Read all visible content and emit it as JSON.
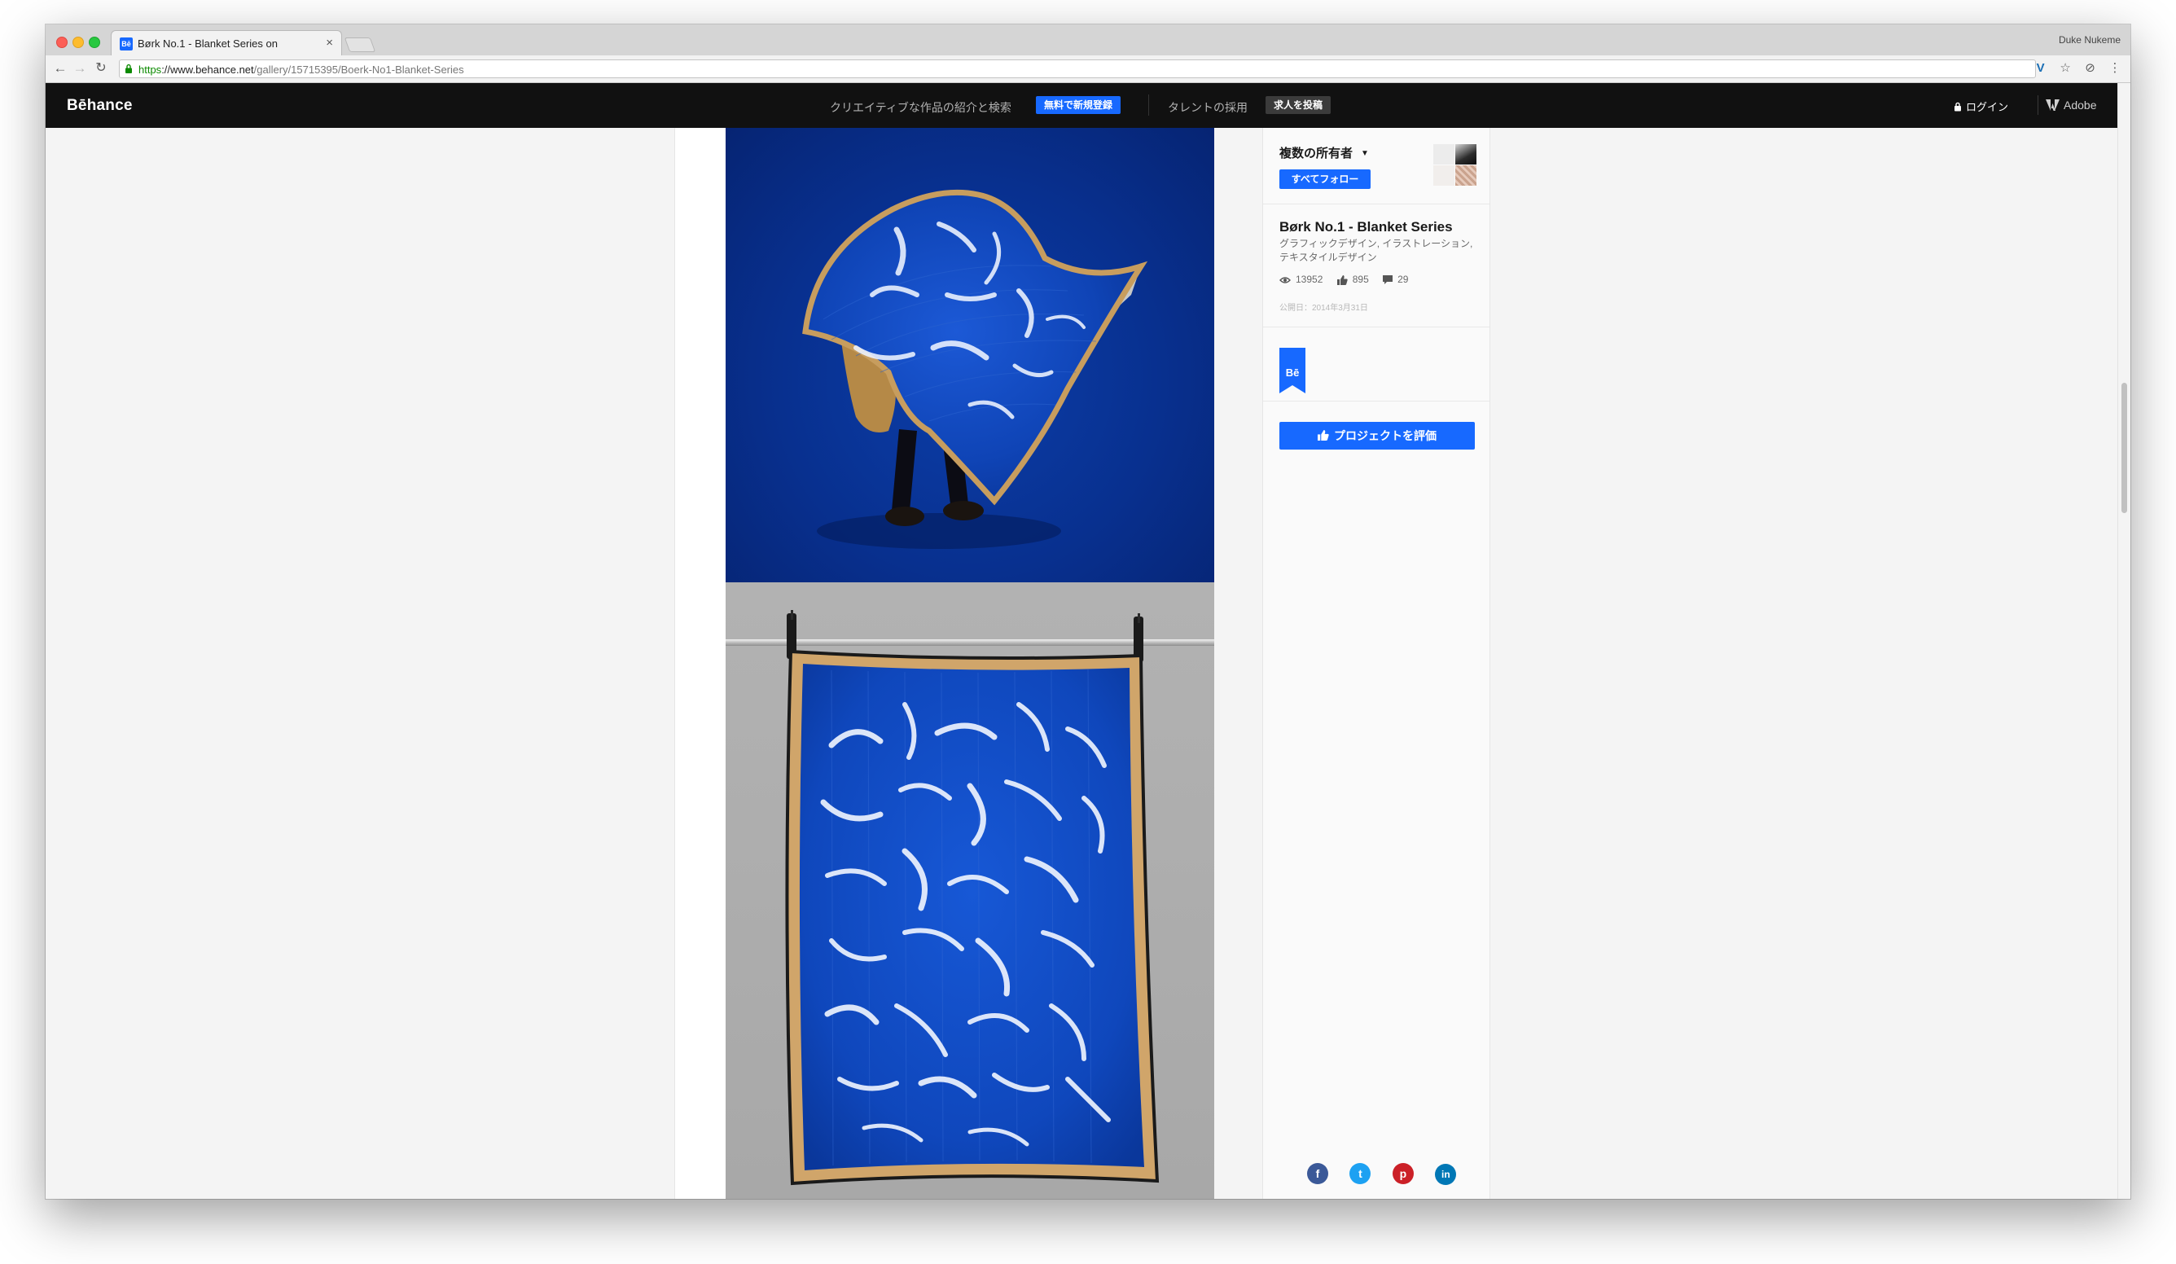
{
  "browser": {
    "tab_title": "Børk No.1 - Blanket Series on",
    "tab_favicon": "Bē",
    "tab_close": "×",
    "profile_name": "Duke Nukeme",
    "url_scheme": "https",
    "url_host": "://www.behance.net",
    "url_path": "/gallery/15715395/Boerk-No1-Blanket-Series",
    "nav_back": "←",
    "nav_forward": "→",
    "nav_reload": "↻",
    "ext_icon": "V",
    "star_icon": "☆",
    "block_icon": "⊘",
    "menu_icon": "⋮"
  },
  "behance_nav": {
    "logo": "Bēhance",
    "creative_link": "クリエイティブな作品の紹介と検索",
    "signup_button": "無料で新規登録",
    "talent_link": "タレントの採用",
    "post_job_button": "求人を投稿",
    "login": "ログイン",
    "adobe": "Adobe"
  },
  "sidebar": {
    "owners_label": "複数の所有者",
    "owners_caret": "▼",
    "follow_all": "すべてフォロー",
    "project_title": "Børk No.1 - Blanket Series",
    "fields": "グラフィックデザイン, イラストレーション, テキスタイルデザイン",
    "views": "13952",
    "appreciations": "895",
    "comments": "29",
    "published": "公開日：2014年3月31日",
    "badge_text": "Bē",
    "appreciate_button": "プロジェクトを評価",
    "share": {
      "facebook": "f",
      "twitter": "t",
      "pinterest": "p",
      "linkedin": "in"
    }
  },
  "colors": {
    "behance_blue": "#1769ff",
    "nav_bg": "#111111",
    "artwork_blue": "#0a3aa8"
  }
}
